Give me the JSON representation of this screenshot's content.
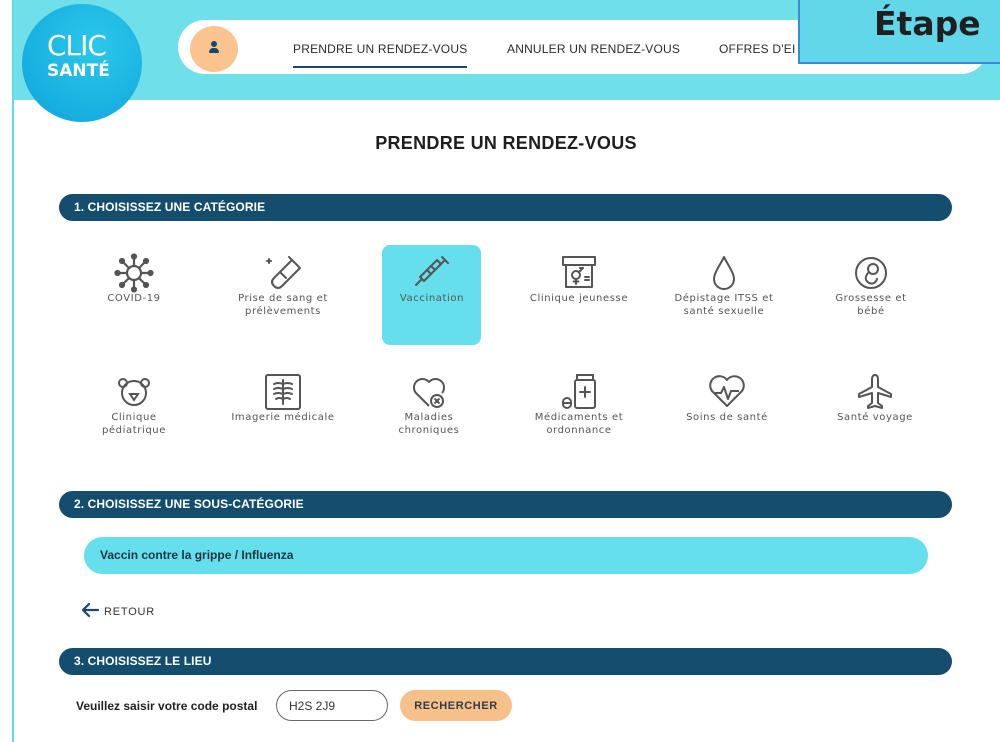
{
  "brand": {
    "line1": "CLIC",
    "line2": "SANTÉ"
  },
  "nav": {
    "items": [
      {
        "label": "PRENDRE UN RENDEZ-VOUS",
        "active": true
      },
      {
        "label": "ANNULER UN RENDEZ-VOUS",
        "active": false
      },
      {
        "label": "OFFRES D'EI",
        "active": false
      }
    ]
  },
  "overlay": {
    "label": "Étape"
  },
  "page_title": "PRENDRE UN RENDEZ-VOUS",
  "sections": {
    "s1": "1. CHOISISSEZ UNE CATÉGORIE",
    "s2": "2. CHOISISSEZ UNE SOUS-CATÉGORIE",
    "s3": "3. CHOISISSEZ LE LIEU"
  },
  "categories": [
    {
      "label": "COVID-19",
      "icon": "virus-icon"
    },
    {
      "label": "Prise de sang et\nprélèvements",
      "icon": "test-tube-icon"
    },
    {
      "label": "Vaccination",
      "icon": "syringe-icon",
      "selected": true
    },
    {
      "label": "Clinique jeunesse",
      "icon": "gender-sign-icon"
    },
    {
      "label": "Dépistage ITSS et\nsanté sexuelle",
      "icon": "drop-icon"
    },
    {
      "label": "Grossesse et\nbébé",
      "icon": "fetus-icon"
    },
    {
      "label": "Clinique\npédiatrique",
      "icon": "teddy-bear-icon"
    },
    {
      "label": "Imagerie médicale",
      "icon": "xray-icon"
    },
    {
      "label": "Maladies\nchroniques",
      "icon": "heart-x-icon"
    },
    {
      "label": "Médicaments et\nordonnance",
      "icon": "pill-bottle-icon"
    },
    {
      "label": "Soins de santé",
      "icon": "heart-pulse-icon"
    },
    {
      "label": "Santé voyage",
      "icon": "airplane-icon"
    }
  ],
  "subcategory": {
    "label": "Vaccin contre la grippe / Influenza"
  },
  "back": {
    "label": "RETOUR"
  },
  "location": {
    "label": "Veuillez saisir votre code postal",
    "postal_value": "H2S 2J9",
    "search_label": "RECHERCHER"
  },
  "colors": {
    "header": "#6fdfe9",
    "section_bar": "#144d6e",
    "selected": "#66dfec",
    "button": "#f7c089",
    "logo": "#17aee0"
  }
}
